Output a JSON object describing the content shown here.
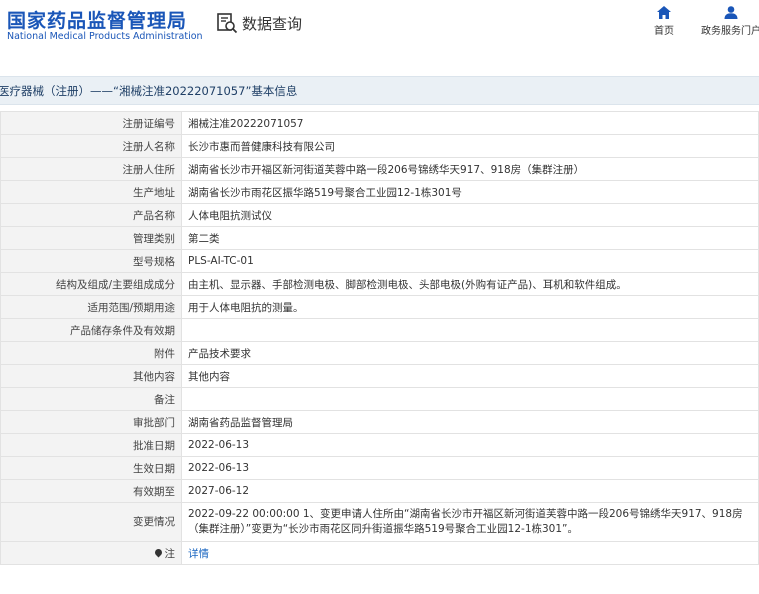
{
  "header": {
    "logo_cn": "国家药品监督管理局",
    "logo_en": "National Medical Products Administration",
    "query_label": "数据查询",
    "nav": [
      {
        "label": "首页",
        "icon": "home-icon"
      },
      {
        "label": "政务服务门户",
        "icon": "user-icon"
      }
    ],
    "brand_color": "#1a56b8"
  },
  "breadcrumb": "医疗器械（注册）——“湘械注准20222071057”基本信息",
  "rows": [
    {
      "label": "注册证编号",
      "value": "湘械注准20222071057"
    },
    {
      "label": "注册人名称",
      "value": "长沙市惠而普健康科技有限公司"
    },
    {
      "label": "注册人住所",
      "value": "湖南省长沙市开福区新河街道芙蓉中路一段206号锦绣华天917、918房（集群注册）"
    },
    {
      "label": "生产地址",
      "value": "湖南省长沙市雨花区振华路519号聚合工业园12-1栋301号"
    },
    {
      "label": "产品名称",
      "value": "人体电阻抗测试仪"
    },
    {
      "label": "管理类别",
      "value": "第二类"
    },
    {
      "label": "型号规格",
      "value": "PLS-AI-TC-01"
    },
    {
      "label": "结构及组成/主要组成成分",
      "value": "由主机、显示器、手部检测电极、脚部检测电极、头部电极(外购有证产品)、耳机和软件组成。"
    },
    {
      "label": "适用范围/预期用途",
      "value": "用于人体电阻抗的测量。"
    },
    {
      "label": "产品储存条件及有效期",
      "value": ""
    },
    {
      "label": "附件",
      "value": "产品技术要求"
    },
    {
      "label": "其他内容",
      "value": "其他内容"
    },
    {
      "label": "备注",
      "value": ""
    },
    {
      "label": "审批部门",
      "value": "湖南省药品监督管理局"
    },
    {
      "label": "批准日期",
      "value": "2022-06-13"
    },
    {
      "label": "生效日期",
      "value": "2022-06-13"
    },
    {
      "label": "有效期至",
      "value": "2027-06-12"
    },
    {
      "label": "变更情况",
      "value": "2022-09-22 00:00:00 1、变更申请人住所由“湖南省长沙市开福区新河街道芙蓉中路一段206号锦绣华天917、918房（集群注册）”变更为“长沙市雨花区同升街道振华路519号聚合工业园12-1栋301”。"
    }
  ],
  "note": {
    "label": "注",
    "link": "详情",
    "icon": "location-pin-icon"
  }
}
